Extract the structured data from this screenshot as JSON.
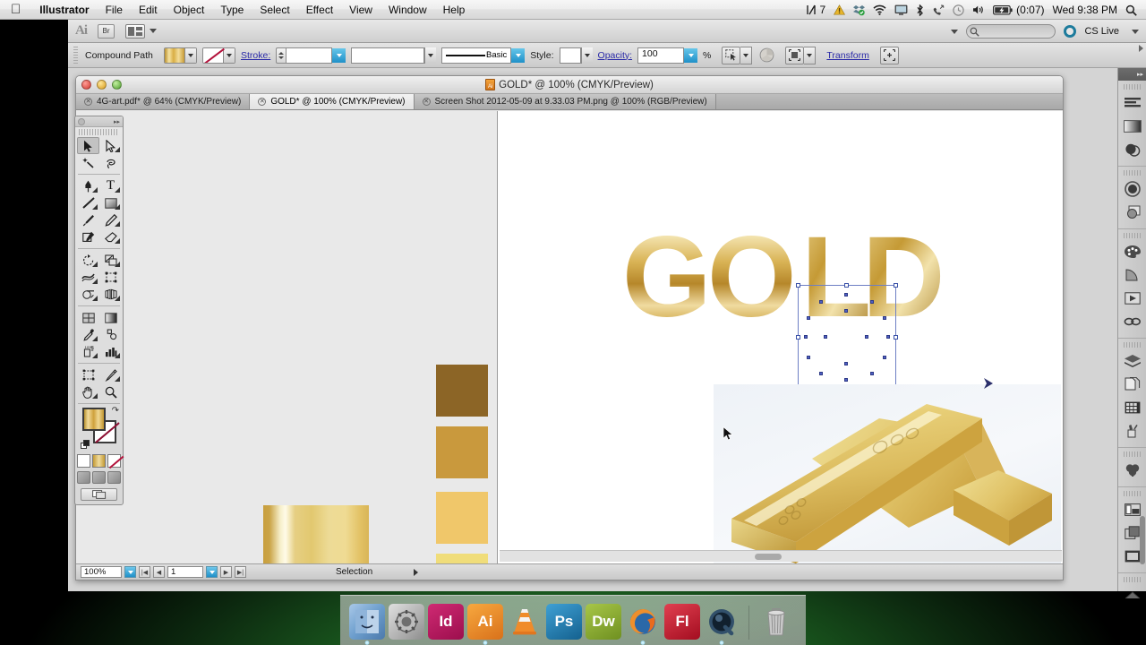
{
  "menubar": {
    "apple_icon": "apple-logo",
    "items": [
      {
        "label": "Illustrator",
        "bold": true
      },
      {
        "label": "File",
        "bold": false
      },
      {
        "label": "Edit",
        "bold": false
      },
      {
        "label": "Object",
        "bold": false
      },
      {
        "label": "Type",
        "bold": false
      },
      {
        "label": "Select",
        "bold": false
      },
      {
        "label": "Effect",
        "bold": false
      },
      {
        "label": "View",
        "bold": false
      },
      {
        "label": "Window",
        "bold": false
      },
      {
        "label": "Help",
        "bold": false
      }
    ],
    "status_items": [
      {
        "name": "airplay-indicator",
        "label": "7"
      },
      {
        "name": "warning-icon",
        "label": ""
      },
      {
        "name": "dropbox-icon",
        "label": ""
      },
      {
        "name": "wifi-icon",
        "label": ""
      },
      {
        "name": "display-icon",
        "label": ""
      },
      {
        "name": "bluetooth-icon",
        "label": ""
      },
      {
        "name": "phone-icon",
        "label": ""
      },
      {
        "name": "time-machine-icon",
        "label": ""
      },
      {
        "name": "volume-icon",
        "label": ""
      }
    ],
    "battery_label": "(0:07)",
    "clock": "Wed 9:38 PM",
    "search_icon": "spotlight-search-icon"
  },
  "appbar": {
    "logo": "Ai",
    "bridge_label": "Br",
    "arrange_label": "arrange-documents",
    "search_placeholder": "",
    "cslive_label": "CS Live"
  },
  "controlbar": {
    "object_type": "Compound Path",
    "fill_label": "fill-swatch",
    "stroke_swatch_label": "stroke-swatch-none",
    "stroke_label": "Stroke:",
    "stroke_weight": "",
    "stroke_profile": "",
    "brush_label": "Basic",
    "style_label": "Style:",
    "opacity_label": "Opacity:",
    "opacity_value": "100",
    "percent_sign": "%",
    "transform_label": "Transform",
    "colors": {
      "fill_gold": "#d4a83c",
      "accent_blue": "#2a2aa8",
      "none_red": "#b3123b"
    }
  },
  "document": {
    "title": "GOLD* @ 100% (CMYK/Preview)",
    "tabs": [
      {
        "label": "4G-art.pdf* @ 64% (CMYK/Preview)",
        "active": false
      },
      {
        "label": "GOLD* @ 100% (CMYK/Preview)",
        "active": true
      },
      {
        "label": "Screen Shot 2012-05-09 at 9.33.03 PM.png @ 100% (RGB/Preview)",
        "active": false
      }
    ],
    "traffic_lights": [
      "close",
      "minimize",
      "zoom"
    ]
  },
  "statusbar": {
    "zoom_level": "100%",
    "page_number": "1",
    "tool_status": "Selection",
    "nav_first": "|◀",
    "nav_prev": "◀",
    "nav_next": "▶",
    "nav_last": "▶|"
  },
  "toolbox": {
    "tools": [
      {
        "name": "selection-tool",
        "selected": true,
        "sub": false
      },
      {
        "name": "direct-selection-tool",
        "selected": false,
        "sub": true
      },
      {
        "name": "magic-wand-tool",
        "selected": false,
        "sub": false
      },
      {
        "name": "lasso-tool",
        "selected": false,
        "sub": false
      },
      {
        "name": "pen-tool",
        "selected": false,
        "sub": true
      },
      {
        "name": "type-tool",
        "selected": false,
        "sub": true
      },
      {
        "name": "line-segment-tool",
        "selected": false,
        "sub": true
      },
      {
        "name": "rectangle-tool",
        "selected": false,
        "sub": true
      },
      {
        "name": "paintbrush-tool",
        "selected": false,
        "sub": false
      },
      {
        "name": "pencil-tool",
        "selected": false,
        "sub": true
      },
      {
        "name": "blob-brush-tool",
        "selected": false,
        "sub": false
      },
      {
        "name": "eraser-tool",
        "selected": false,
        "sub": true
      },
      {
        "name": "rotate-tool",
        "selected": false,
        "sub": true
      },
      {
        "name": "scale-tool",
        "selected": false,
        "sub": true
      },
      {
        "name": "width-tool",
        "selected": false,
        "sub": true
      },
      {
        "name": "free-transform-tool",
        "selected": false,
        "sub": false
      },
      {
        "name": "shape-builder-tool",
        "selected": false,
        "sub": true
      },
      {
        "name": "perspective-grid-tool",
        "selected": false,
        "sub": true
      },
      {
        "name": "mesh-tool",
        "selected": false,
        "sub": false
      },
      {
        "name": "gradient-tool",
        "selected": false,
        "sub": false
      },
      {
        "name": "eyedropper-tool",
        "selected": false,
        "sub": true
      },
      {
        "name": "blend-tool",
        "selected": false,
        "sub": false
      },
      {
        "name": "symbol-sprayer-tool",
        "selected": false,
        "sub": true
      },
      {
        "name": "column-graph-tool",
        "selected": false,
        "sub": true
      },
      {
        "name": "artboard-tool",
        "selected": false,
        "sub": false
      },
      {
        "name": "slice-tool",
        "selected": false,
        "sub": true
      },
      {
        "name": "hand-tool",
        "selected": false,
        "sub": true
      },
      {
        "name": "zoom-tool",
        "selected": false,
        "sub": false
      }
    ],
    "fill_color": "#d4a83c",
    "stroke_color": "none",
    "swap_icon": "swap-fill-stroke-icon",
    "default_icon": "default-fill-stroke-icon",
    "paint_modes": [
      "color-mode",
      "gradient-mode",
      "none-mode"
    ],
    "drawing_modes": [
      "draw-normal",
      "draw-behind",
      "draw-inside"
    ],
    "screen_mode": "change-screen-mode"
  },
  "right_dock": {
    "panels": [
      {
        "name": "align-panel-icon",
        "group": 1
      },
      {
        "name": "gradient-panel-icon",
        "group": 1
      },
      {
        "name": "transparency-panel-icon",
        "group": 1
      },
      {
        "name": "appearance-panel-icon",
        "group": 2
      },
      {
        "name": "graphic-styles-panel-icon",
        "group": 2
      },
      {
        "name": "color-panel-icon",
        "group": 3
      },
      {
        "name": "color-guide-panel-icon",
        "group": 3
      },
      {
        "name": "symbols-panel-icon",
        "group": 3
      },
      {
        "name": "links-panel-icon",
        "group": 3
      },
      {
        "name": "layers-panel-icon",
        "group": 4
      },
      {
        "name": "artboards-panel-icon",
        "group": 4
      },
      {
        "name": "swatches-panel-icon",
        "group": 4
      },
      {
        "name": "brushes-panel-icon",
        "group": 4
      },
      {
        "name": "pathfinder-panel-icon",
        "group": 5
      },
      {
        "name": "stroke-panel-icon",
        "group": 6
      },
      {
        "name": "navigator-panel-icon",
        "group": 6
      },
      {
        "name": "separations-preview-icon",
        "group": 6
      }
    ]
  },
  "artwork": {
    "headline_letters": [
      "G",
      "O",
      "L",
      "D"
    ],
    "selected_letter": "O",
    "gradient_bars": [
      {
        "name": "gradient-bar-top"
      },
      {
        "name": "gradient-bar-bottom"
      }
    ],
    "swatch_rects": [
      {
        "name": "swatch-dark-gold",
        "color": "#8c6526"
      },
      {
        "name": "swatch-medium-gold",
        "color": "#c9993d"
      },
      {
        "name": "swatch-light-gold",
        "color": "#f0c76a"
      },
      {
        "name": "swatch-pale-gold",
        "color": "#f0dd7a"
      }
    ],
    "photo_name": "gold-bars-photo"
  },
  "os_dock": {
    "items": [
      {
        "name": "finder",
        "label": "",
        "color": "#5b8fc9"
      },
      {
        "name": "system-preferences",
        "label": "",
        "color": "#8a8a8a"
      },
      {
        "name": "indesign",
        "label": "Id",
        "color": "#b5195c"
      },
      {
        "name": "illustrator",
        "label": "Ai",
        "color": "#e98a26"
      },
      {
        "name": "vlc",
        "label": "",
        "color": "#f0822a"
      },
      {
        "name": "photoshop",
        "label": "Ps",
        "color": "#2b7fb8"
      },
      {
        "name": "dreamweaver",
        "label": "Dw",
        "color": "#8aaa36"
      },
      {
        "name": "firefox",
        "label": "",
        "color": "#e8742a"
      },
      {
        "name": "flash",
        "label": "Fl",
        "color": "#cf2233"
      },
      {
        "name": "quicktime",
        "label": "",
        "color": "#4a5a6b"
      },
      {
        "name": "trash",
        "label": "",
        "color": "#c8c8c8"
      }
    ]
  }
}
